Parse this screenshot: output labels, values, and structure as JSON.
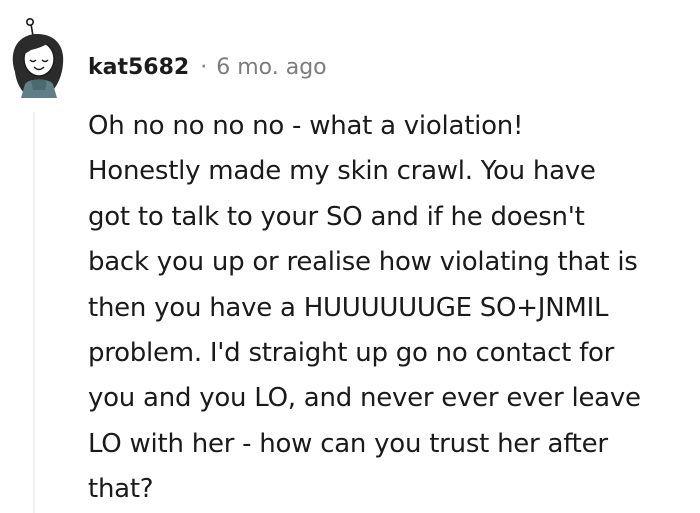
{
  "comment": {
    "author": "kat5682",
    "separator": "·",
    "timestamp": "6 mo. ago",
    "body": "Oh no no no no - what a violation!\nHonestly made my skin crawl. You have\ngot to talk to your SO and if he doesn't\nback you up or realise how violating that is\nthen you have a HUUUUUUGE SO+JNMIL\nproblem. I'd straight up go no contact for\nyou and you LO, and never ever ever leave\nLO with her - how can you trust her after\nthat?",
    "avatar_icon": "user-avatar-icon"
  },
  "colors": {
    "text": "#1a1a1b",
    "muted": "#7c7c7c",
    "thread_line": "#edeff1"
  }
}
